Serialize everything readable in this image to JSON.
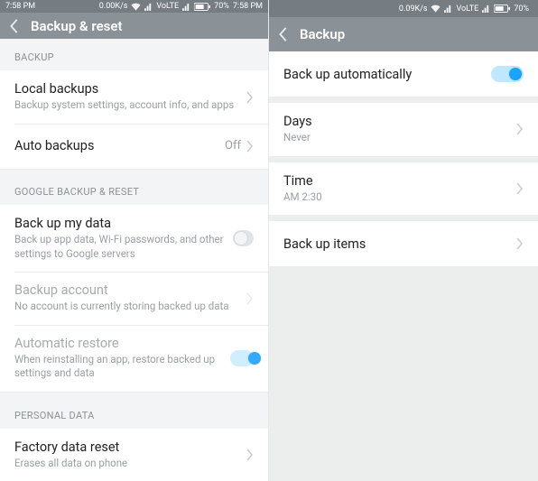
{
  "left": {
    "statusbar": {
      "time_left": "7:58 PM",
      "speed": "0.00K/s",
      "network": "VoLTE",
      "battery": "70%",
      "time_right": "7:58 PM"
    },
    "title": "Backup & reset",
    "sections": {
      "backup_hdr": "BACKUP",
      "local_backups": {
        "title": "Local backups",
        "sub": "Backup system settings, account info, and apps"
      },
      "auto_backups": {
        "title": "Auto backups",
        "value": "Off"
      },
      "google_hdr": "GOOGLE BACKUP & RESET",
      "backup_my_data": {
        "title": "Back up my data",
        "sub": "Back up app data, Wi-Fi passwords, and other settings to Google servers"
      },
      "backup_account": {
        "title": "Backup account",
        "sub": "No account is currently storing backed up data"
      },
      "auto_restore": {
        "title": "Automatic restore",
        "sub": "When reinstalling an app, restore backed up settings and data"
      },
      "personal_hdr": "PERSONAL DATA",
      "factory_reset": {
        "title": "Factory data reset",
        "sub": "Erases all data on phone"
      }
    }
  },
  "right": {
    "statusbar": {
      "time_left": "",
      "speed": "0.09K/s",
      "network": "VoLTE",
      "battery": "70%",
      "time_right": ""
    },
    "title": "Backup",
    "rows": {
      "auto": {
        "title": "Back up automatically"
      },
      "days": {
        "title": "Days",
        "sub": "Never"
      },
      "time": {
        "title": "Time",
        "sub": "AM 2:30"
      },
      "items": {
        "title": "Back up items"
      }
    }
  }
}
